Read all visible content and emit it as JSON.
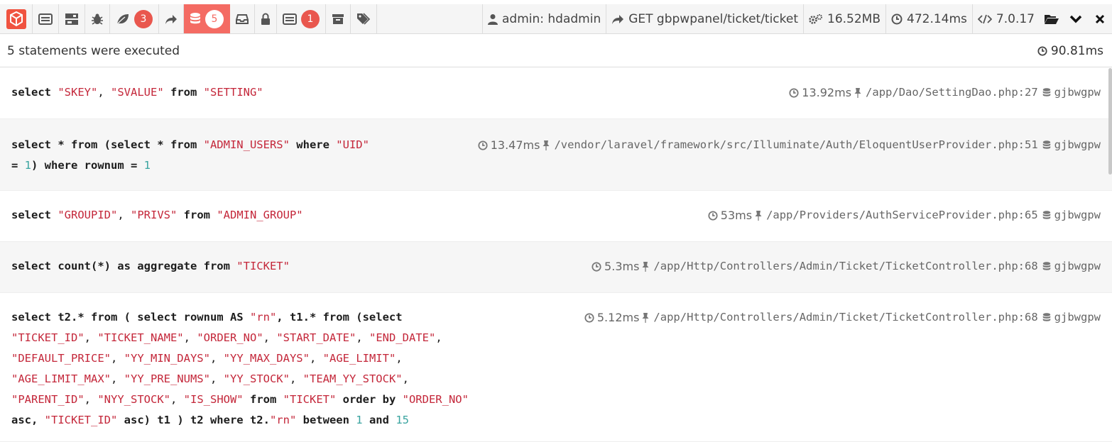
{
  "toolbar": {
    "badges": {
      "views": "3",
      "queries": "5",
      "mails": "1"
    },
    "user": "admin: hdadmin",
    "route": "GET gbpwpanel/ticket/ticket",
    "memory": "16.52MB",
    "time": "472.14ms",
    "version": "7.0.17"
  },
  "summary": {
    "text": "5 statements were executed",
    "total_time": "90.81ms"
  },
  "statements": [
    {
      "sql": [
        {
          "t": "k",
          "v": "select "
        },
        {
          "t": "s",
          "v": "\"SKEY\""
        },
        {
          "t": "p",
          "v": ", "
        },
        {
          "t": "s",
          "v": "\"SVALUE\""
        },
        {
          "t": "k",
          "v": " from "
        },
        {
          "t": "s",
          "v": "\"SETTING\""
        }
      ],
      "duration": "13.92ms",
      "file": "/app/Dao/SettingDao.php:27",
      "connection": "gjbwgpw"
    },
    {
      "sql": [
        {
          "t": "k",
          "v": "select * from (select * from "
        },
        {
          "t": "s",
          "v": "\"ADMIN_USERS\""
        },
        {
          "t": "k",
          "v": " where "
        },
        {
          "t": "s",
          "v": "\"UID\""
        },
        {
          "t": "k",
          "v": "\n= "
        },
        {
          "t": "n",
          "v": "1"
        },
        {
          "t": "k",
          "v": ") where rownum = "
        },
        {
          "t": "n",
          "v": "1"
        }
      ],
      "duration": "13.47ms",
      "file": "/vendor/laravel/framework/src/Illuminate/Auth/EloquentUserProvider.php:51",
      "connection": "gjbwgpw"
    },
    {
      "sql": [
        {
          "t": "k",
          "v": "select "
        },
        {
          "t": "s",
          "v": "\"GROUPID\""
        },
        {
          "t": "p",
          "v": ", "
        },
        {
          "t": "s",
          "v": "\"PRIVS\""
        },
        {
          "t": "k",
          "v": " from "
        },
        {
          "t": "s",
          "v": "\"ADMIN_GROUP\""
        }
      ],
      "duration": "53ms",
      "file": "/app/Providers/AuthServiceProvider.php:65",
      "connection": "gjbwgpw"
    },
    {
      "sql": [
        {
          "t": "k",
          "v": "select count(*) as aggregate from "
        },
        {
          "t": "s",
          "v": "\"TICKET\""
        }
      ],
      "duration": "5.3ms",
      "file": "/app/Http/Controllers/Admin/Ticket/TicketController.php:68",
      "connection": "gjbwgpw"
    },
    {
      "sql": [
        {
          "t": "k",
          "v": "select t2.* from ( select rownum AS "
        },
        {
          "t": "s",
          "v": "\"rn\""
        },
        {
          "t": "k",
          "v": ", t1.* from (select\n"
        },
        {
          "t": "s",
          "v": "\"TICKET_ID\""
        },
        {
          "t": "p",
          "v": ", "
        },
        {
          "t": "s",
          "v": "\"TICKET_NAME\""
        },
        {
          "t": "p",
          "v": ", "
        },
        {
          "t": "s",
          "v": "\"ORDER_NO\""
        },
        {
          "t": "p",
          "v": ", "
        },
        {
          "t": "s",
          "v": "\"START_DATE\""
        },
        {
          "t": "p",
          "v": ", "
        },
        {
          "t": "s",
          "v": "\"END_DATE\""
        },
        {
          "t": "p",
          "v": ",\n"
        },
        {
          "t": "s",
          "v": "\"DEFAULT_PRICE\""
        },
        {
          "t": "p",
          "v": ", "
        },
        {
          "t": "s",
          "v": "\"YY_MIN_DAYS\""
        },
        {
          "t": "p",
          "v": ", "
        },
        {
          "t": "s",
          "v": "\"YY_MAX_DAYS\""
        },
        {
          "t": "p",
          "v": ", "
        },
        {
          "t": "s",
          "v": "\"AGE_LIMIT\""
        },
        {
          "t": "p",
          "v": ",\n"
        },
        {
          "t": "s",
          "v": "\"AGE_LIMIT_MAX\""
        },
        {
          "t": "p",
          "v": ", "
        },
        {
          "t": "s",
          "v": "\"YY_PRE_NUMS\""
        },
        {
          "t": "p",
          "v": ", "
        },
        {
          "t": "s",
          "v": "\"YY_STOCK\""
        },
        {
          "t": "p",
          "v": ", "
        },
        {
          "t": "s",
          "v": "\"TEAM_YY_STOCK\""
        },
        {
          "t": "p",
          "v": ",\n"
        },
        {
          "t": "s",
          "v": "\"PARENT_ID\""
        },
        {
          "t": "p",
          "v": ", "
        },
        {
          "t": "s",
          "v": "\"NYY_STOCK\""
        },
        {
          "t": "p",
          "v": ", "
        },
        {
          "t": "s",
          "v": "\"IS_SHOW\""
        },
        {
          "t": "k",
          "v": " from "
        },
        {
          "t": "s",
          "v": "\"TICKET\""
        },
        {
          "t": "k",
          "v": " order by "
        },
        {
          "t": "s",
          "v": "\"ORDER_NO\""
        },
        {
          "t": "k",
          "v": "\nasc, "
        },
        {
          "t": "s",
          "v": "\"TICKET_ID\""
        },
        {
          "t": "k",
          "v": " asc) t1 ) t2 where t2."
        },
        {
          "t": "s",
          "v": "\"rn\""
        },
        {
          "t": "k",
          "v": " between "
        },
        {
          "t": "n",
          "v": "1"
        },
        {
          "t": "k",
          "v": " and "
        },
        {
          "t": "n",
          "v": "15"
        }
      ],
      "duration": "5.12ms",
      "file": "/app/Http/Controllers/Admin/Ticket/TicketController.php:68",
      "connection": "gjbwgpw"
    }
  ]
}
